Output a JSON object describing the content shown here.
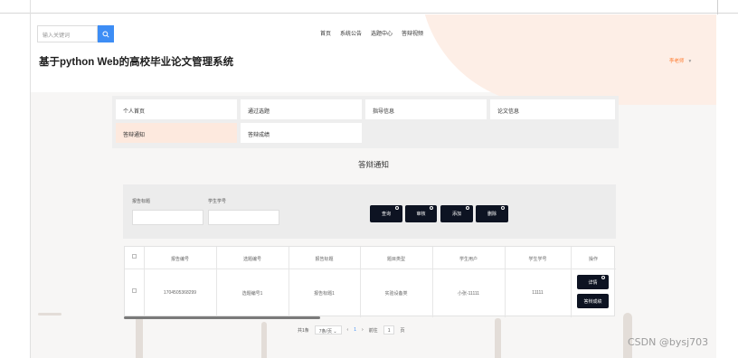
{
  "header": {
    "search_placeholder": "输入关键词",
    "nav": [
      "首页",
      "系统公告",
      "选题中心",
      "答辩视频"
    ],
    "site_title": "基于python Web的高校毕业论文管理系统",
    "user_label": "李老师",
    "user_caret": "▾"
  },
  "menu": {
    "items": [
      "个人首页",
      "通过选题",
      "指导信息",
      "论文信息",
      "答辩通知",
      "答辩成绩"
    ],
    "active": "答辩通知"
  },
  "section_title": "答辩通知",
  "filters": {
    "labels": [
      "报告标题",
      "学生学号"
    ],
    "values": [
      "",
      ""
    ]
  },
  "actions": [
    "查询",
    "审核",
    "添加",
    "删除"
  ],
  "table": {
    "headers": [
      "报告编号",
      "选题编号",
      "报告标题",
      "题目类型",
      "学生用户",
      "学生学号",
      "操作"
    ],
    "rows": [
      {
        "cells": [
          "1704505368299",
          "选题编号1",
          "报告标题1",
          "实验设备类",
          "小张-11111",
          "11111"
        ],
        "buttons": [
          "详情",
          "答辩成绩"
        ]
      }
    ]
  },
  "pagination": {
    "total": "共1条",
    "page_size": "7条/页",
    "prev": "‹",
    "current": "1",
    "next": "›",
    "goto_label": "前往",
    "goto_value": "1",
    "goto_suffix": "页"
  },
  "watermark": "CSDN @bysj703",
  "colors": {
    "accent_blue": "#3d8df5",
    "dark_button": "#0d1322",
    "active_menu": "#fde9de",
    "user_orange": "#ff7a2e"
  }
}
